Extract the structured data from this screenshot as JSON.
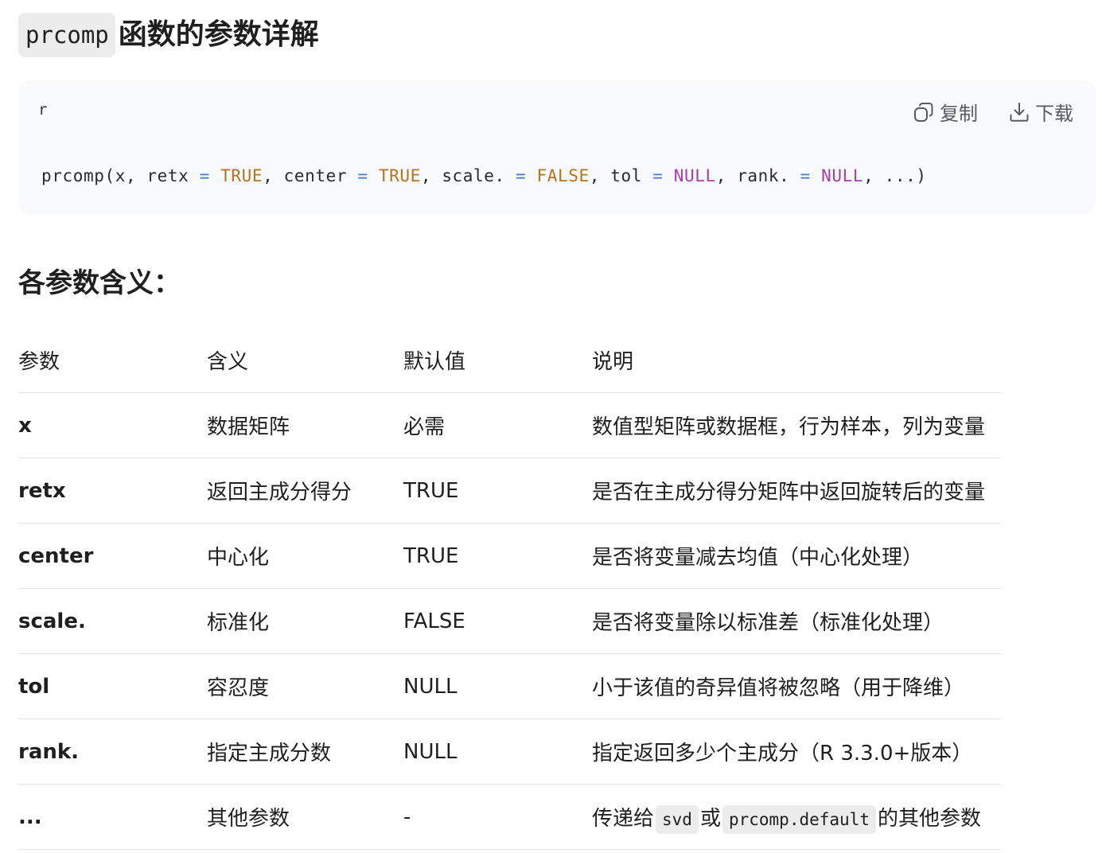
{
  "header": {
    "code_word": "prcomp",
    "title_rest": "函数的参数详解"
  },
  "code_block": {
    "language": "r",
    "copy_label": "复制",
    "download_label": "下载",
    "tokens": [
      {
        "t": "prcomp(x, retx ",
        "c": "plain"
      },
      {
        "t": "=",
        "c": "op"
      },
      {
        "t": " ",
        "c": "plain"
      },
      {
        "t": "TRUE",
        "c": "bool"
      },
      {
        "t": ", center ",
        "c": "plain"
      },
      {
        "t": "=",
        "c": "op"
      },
      {
        "t": " ",
        "c": "plain"
      },
      {
        "t": "TRUE",
        "c": "bool"
      },
      {
        "t": ", scale. ",
        "c": "plain"
      },
      {
        "t": "=",
        "c": "op"
      },
      {
        "t": " ",
        "c": "plain"
      },
      {
        "t": "FALSE",
        "c": "bool"
      },
      {
        "t": ", tol ",
        "c": "plain"
      },
      {
        "t": "=",
        "c": "op"
      },
      {
        "t": " ",
        "c": "plain"
      },
      {
        "t": "NULL",
        "c": "null"
      },
      {
        "t": ", rank. ",
        "c": "plain"
      },
      {
        "t": "=",
        "c": "op"
      },
      {
        "t": " ",
        "c": "plain"
      },
      {
        "t": "NULL",
        "c": "null"
      },
      {
        "t": ", ...)",
        "c": "plain"
      }
    ]
  },
  "section": {
    "heading": "各参数含义："
  },
  "table": {
    "headers": [
      "参数",
      "含义",
      "默认值",
      "说明"
    ],
    "rows": [
      {
        "param": "x",
        "meaning": "数据矩阵",
        "default": "必需",
        "desc": "数值型矩阵或数据框，行为样本，列为变量"
      },
      {
        "param": "retx",
        "meaning": "返回主成分得分",
        "default": "TRUE",
        "desc": "是否在主成分得分矩阵中返回旋转后的变量"
      },
      {
        "param": "center",
        "meaning": "中心化",
        "default": "TRUE",
        "desc": "是否将变量减去均值（中心化处理）"
      },
      {
        "param": "scale.",
        "meaning": "标准化",
        "default": "FALSE",
        "desc": "是否将变量除以标准差（标准化处理）"
      },
      {
        "param": "tol",
        "meaning": "容忍度",
        "default": "NULL",
        "desc": "小于该值的奇异值将被忽略（用于降维）"
      },
      {
        "param": "rank.",
        "meaning": "指定主成分数",
        "default": "NULL",
        "desc": "指定返回多少个主成分（R 3.3.0+版本）"
      },
      {
        "param": "...",
        "meaning": "其他参数",
        "default": "-",
        "desc_parts": [
          {
            "t": "传递给",
            "code": false
          },
          {
            "t": "svd",
            "code": true
          },
          {
            "t": "或",
            "code": false
          },
          {
            "t": "prcomp.default",
            "code": true
          },
          {
            "t": "的其他参数",
            "code": false
          }
        ]
      }
    ]
  },
  "colors": {
    "operator": "#3d7bd6",
    "boolean": "#b5741b",
    "null": "#a53fa3",
    "code_bg": "#f8f9fb"
  }
}
